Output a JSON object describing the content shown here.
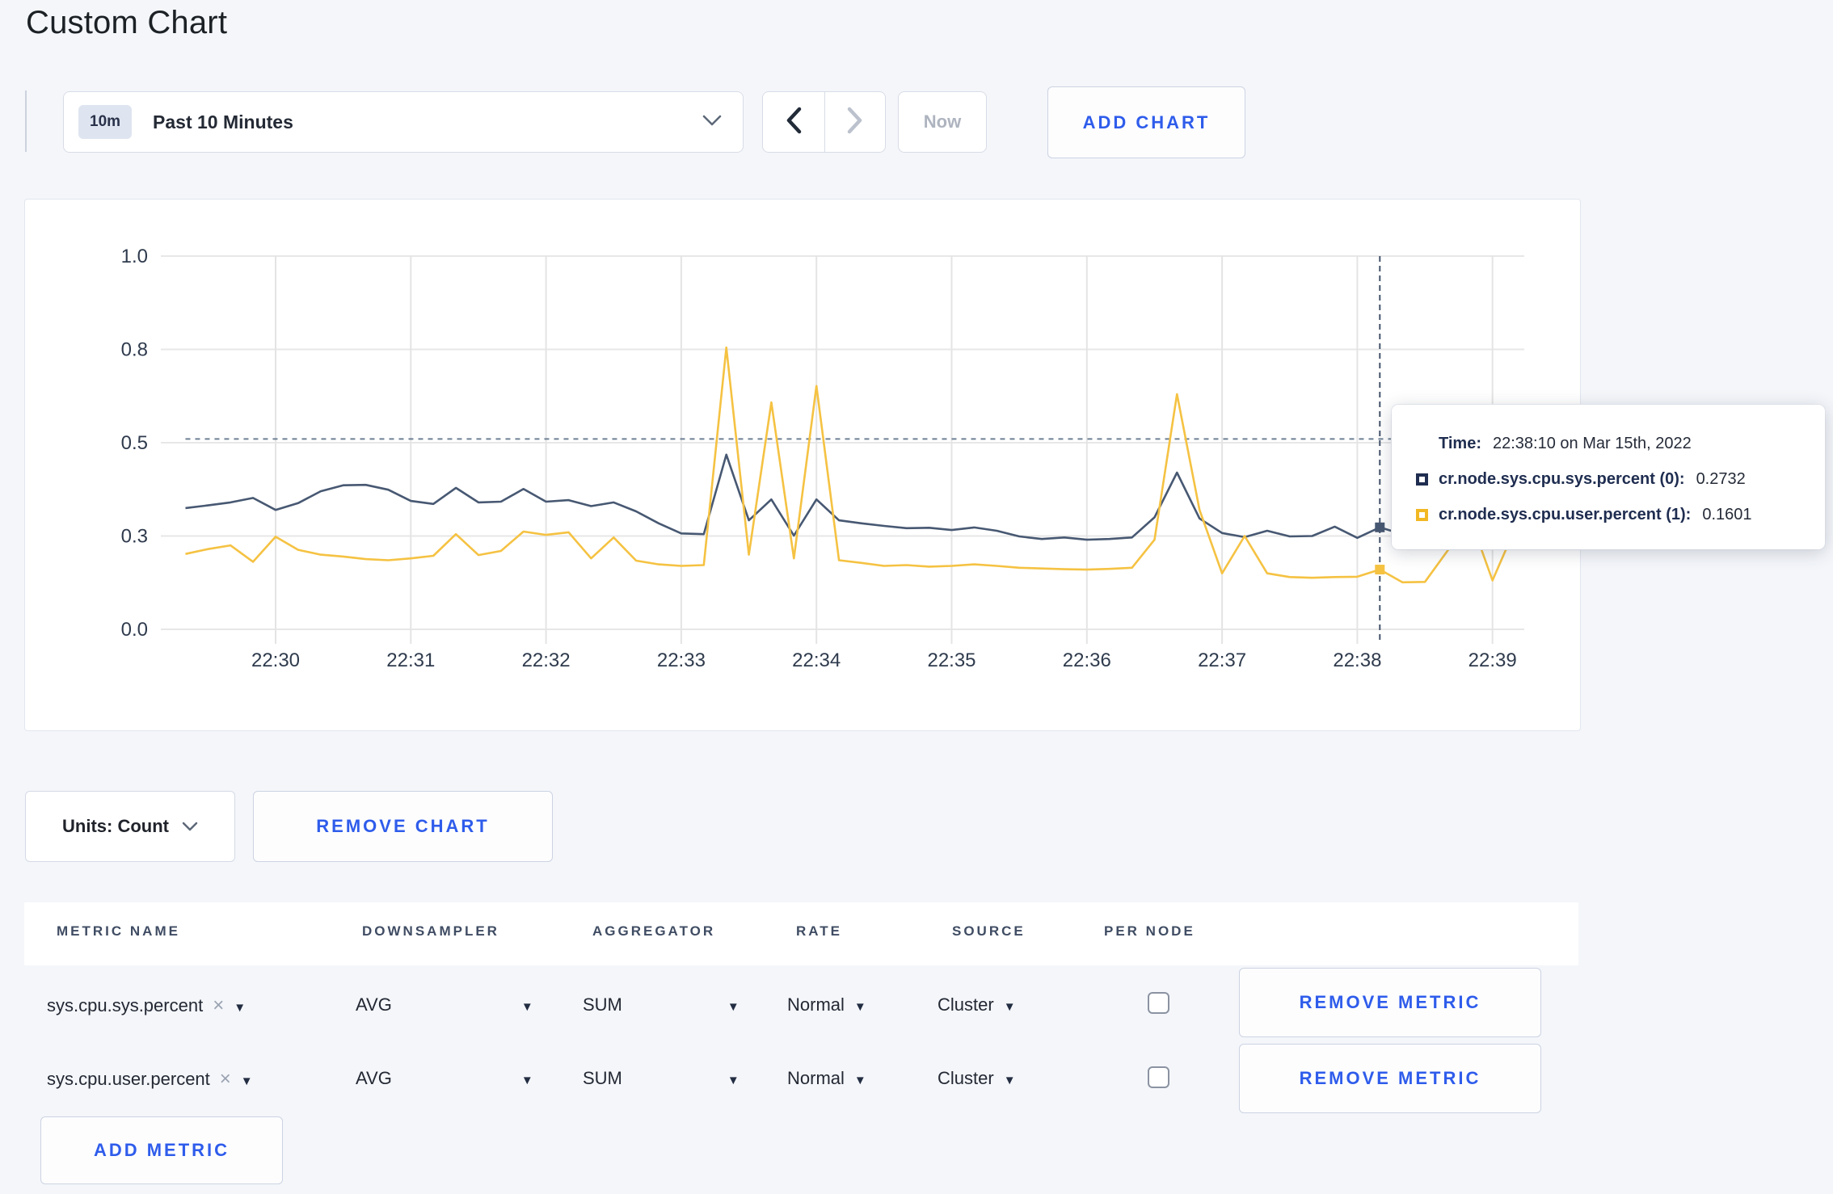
{
  "page": {
    "title": "Custom Chart",
    "background": "#f4f6fa",
    "accent_blue": "#2e5ceb"
  },
  "toolbar": {
    "time_range_badge": "10m",
    "time_range_label": "Past 10 Minutes",
    "prev_label": "chevron-left",
    "next_label": "chevron-right",
    "now_label": "Now",
    "add_chart_label": "ADD CHART"
  },
  "chart_controls": {
    "units_label": "Units: Count",
    "remove_chart_label": "REMOVE CHART"
  },
  "tooltip": {
    "time_label": "Time:",
    "time_value": "22:38:10 on Mar 15th, 2022",
    "series": [
      {
        "label": "cr.node.sys.cpu.sys.percent (0):",
        "value": "0.2732",
        "color": "#1f2d50"
      },
      {
        "label": "cr.node.sys.cpu.user.percent (1):",
        "value": "0.1601",
        "color": "#f2b824"
      }
    ]
  },
  "chart_data": {
    "type": "line",
    "title": "",
    "xlabel": "",
    "ylabel": "",
    "ylim": [
      0,
      1
    ],
    "grid": true,
    "legend_position": "tooltip",
    "start_time": "22:29:20",
    "interval_seconds": 10,
    "x_tick_labels": [
      "22:30",
      "22:31",
      "22:32",
      "22:33",
      "22:34",
      "22:35",
      "22:36",
      "22:37",
      "22:38",
      "22:39"
    ],
    "y_tick_labels": [
      "0.0",
      "0.3",
      "0.5",
      "0.8",
      "1.0"
    ],
    "y_tick_values": [
      0,
      0.25,
      0.5,
      0.75,
      1.0
    ],
    "dashed_hline": 0.51,
    "crosshair": {
      "time": "22:38:10",
      "index": 53
    },
    "series": [
      {
        "name": "cr.node.sys.cpu.sys.percent (0)",
        "color": "#475872",
        "values": [
          0.325,
          0.332,
          0.34,
          0.352,
          0.32,
          0.338,
          0.37,
          0.386,
          0.387,
          0.374,
          0.344,
          0.336,
          0.379,
          0.34,
          0.342,
          0.376,
          0.342,
          0.346,
          0.33,
          0.34,
          0.316,
          0.284,
          0.257,
          0.255,
          0.468,
          0.292,
          0.348,
          0.251,
          0.348,
          0.292,
          0.284,
          0.277,
          0.271,
          0.272,
          0.266,
          0.273,
          0.264,
          0.249,
          0.242,
          0.246,
          0.24,
          0.242,
          0.246,
          0.3,
          0.42,
          0.297,
          0.258,
          0.247,
          0.264,
          0.249,
          0.25,
          0.275,
          0.245,
          0.2732,
          0.255,
          0.26,
          0.27,
          0.28,
          0.285,
          0.29
        ]
      },
      {
        "name": "cr.node.sys.cpu.user.percent (1)",
        "color": "#f5c242",
        "values": [
          0.202,
          0.215,
          0.225,
          0.181,
          0.248,
          0.213,
          0.2,
          0.195,
          0.188,
          0.185,
          0.19,
          0.197,
          0.255,
          0.199,
          0.21,
          0.262,
          0.253,
          0.26,
          0.19,
          0.246,
          0.184,
          0.174,
          0.17,
          0.172,
          0.755,
          0.2,
          0.608,
          0.19,
          0.652,
          0.185,
          0.178,
          0.17,
          0.172,
          0.168,
          0.17,
          0.174,
          0.17,
          0.165,
          0.163,
          0.161,
          0.16,
          0.162,
          0.165,
          0.24,
          0.63,
          0.32,
          0.15,
          0.25,
          0.15,
          0.14,
          0.138,
          0.14,
          0.141,
          0.1601,
          0.126,
          0.127,
          0.21,
          0.3,
          0.131,
          0.27
        ]
      }
    ]
  },
  "metrics_table": {
    "headers": [
      "METRIC NAME",
      "DOWNSAMPLER",
      "AGGREGATOR",
      "RATE",
      "SOURCE",
      "PER NODE"
    ],
    "rows": [
      {
        "metric": "sys.cpu.sys.percent",
        "downsampler": "AVG",
        "aggregator": "SUM",
        "rate": "Normal",
        "source": "Cluster",
        "per_node_checked": false,
        "remove_label": "REMOVE METRIC"
      },
      {
        "metric": "sys.cpu.user.percent",
        "downsampler": "AVG",
        "aggregator": "SUM",
        "rate": "Normal",
        "source": "Cluster",
        "per_node_checked": false,
        "remove_label": "REMOVE METRIC"
      }
    ],
    "add_metric_label": "ADD METRIC"
  }
}
